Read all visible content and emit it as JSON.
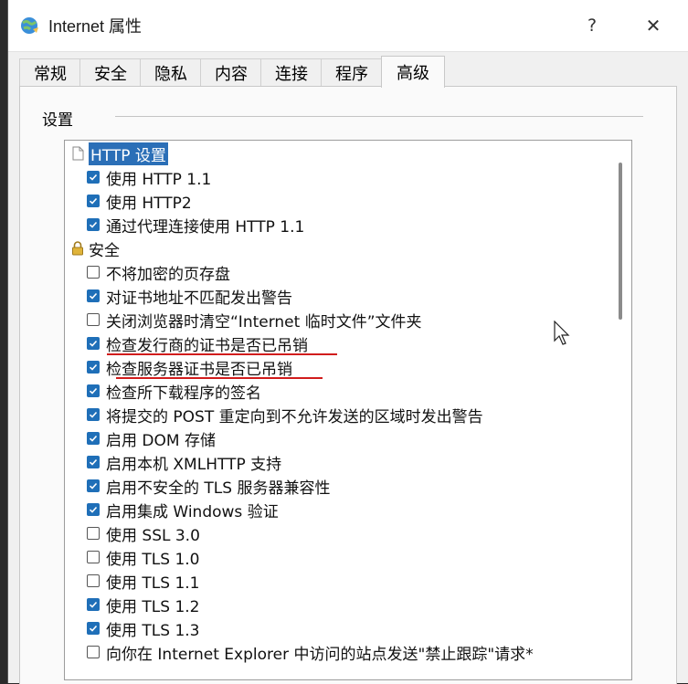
{
  "window": {
    "title": "Internet 属性",
    "help_glyph": "?",
    "close_glyph": "✕"
  },
  "tabs": [
    {
      "label": "常规"
    },
    {
      "label": "安全"
    },
    {
      "label": "隐私"
    },
    {
      "label": "内容"
    },
    {
      "label": "连接"
    },
    {
      "label": "程序"
    },
    {
      "label": "高级",
      "active": true
    }
  ],
  "settings": {
    "group_label": "设置",
    "items": [
      {
        "type": "category",
        "icon": "page-icon",
        "label": "HTTP 设置",
        "selected": true
      },
      {
        "type": "checkbox",
        "checked": true,
        "label": "使用 HTTP 1.1"
      },
      {
        "type": "checkbox",
        "checked": true,
        "label": "使用 HTTP2"
      },
      {
        "type": "checkbox",
        "checked": true,
        "label": "通过代理连接使用 HTTP 1.1"
      },
      {
        "type": "category",
        "icon": "lock-icon",
        "label": "安全"
      },
      {
        "type": "checkbox",
        "checked": false,
        "label": "不将加密的页存盘"
      },
      {
        "type": "checkbox",
        "checked": true,
        "label": "对证书地址不匹配发出警告"
      },
      {
        "type": "checkbox",
        "checked": false,
        "label": "关闭浏览器时清空“Internet 临时文件”文件夹"
      },
      {
        "type": "checkbox",
        "checked": true,
        "label": "检查发行商的证书是否已吊销",
        "annotated": true
      },
      {
        "type": "checkbox",
        "checked": true,
        "label": "检查服务器证书是否已吊销",
        "annotated": true
      },
      {
        "type": "checkbox",
        "checked": true,
        "label": "检查所下载程序的签名"
      },
      {
        "type": "checkbox",
        "checked": true,
        "label": "将提交的 POST 重定向到不允许发送的区域时发出警告"
      },
      {
        "type": "checkbox",
        "checked": true,
        "label": "启用 DOM 存储"
      },
      {
        "type": "checkbox",
        "checked": true,
        "label": "启用本机 XMLHTTP 支持"
      },
      {
        "type": "checkbox",
        "checked": true,
        "label": "启用不安全的 TLS 服务器兼容性"
      },
      {
        "type": "checkbox",
        "checked": true,
        "label": "启用集成 Windows 验证"
      },
      {
        "type": "checkbox",
        "checked": false,
        "label": "使用 SSL 3.0"
      },
      {
        "type": "checkbox",
        "checked": false,
        "label": "使用 TLS 1.0"
      },
      {
        "type": "checkbox",
        "checked": false,
        "label": "使用 TLS 1.1"
      },
      {
        "type": "checkbox",
        "checked": true,
        "label": "使用 TLS 1.2"
      },
      {
        "type": "checkbox",
        "checked": true,
        "label": "使用 TLS 1.3"
      },
      {
        "type": "checkbox",
        "checked": false,
        "label": "向你在 Internet Explorer 中访问的站点发送\"禁止跟踪\"请求*"
      }
    ]
  },
  "colors": {
    "accent": "#1f6fb8",
    "selection": "#2b6fb7",
    "annotation": "#d11c1c"
  }
}
